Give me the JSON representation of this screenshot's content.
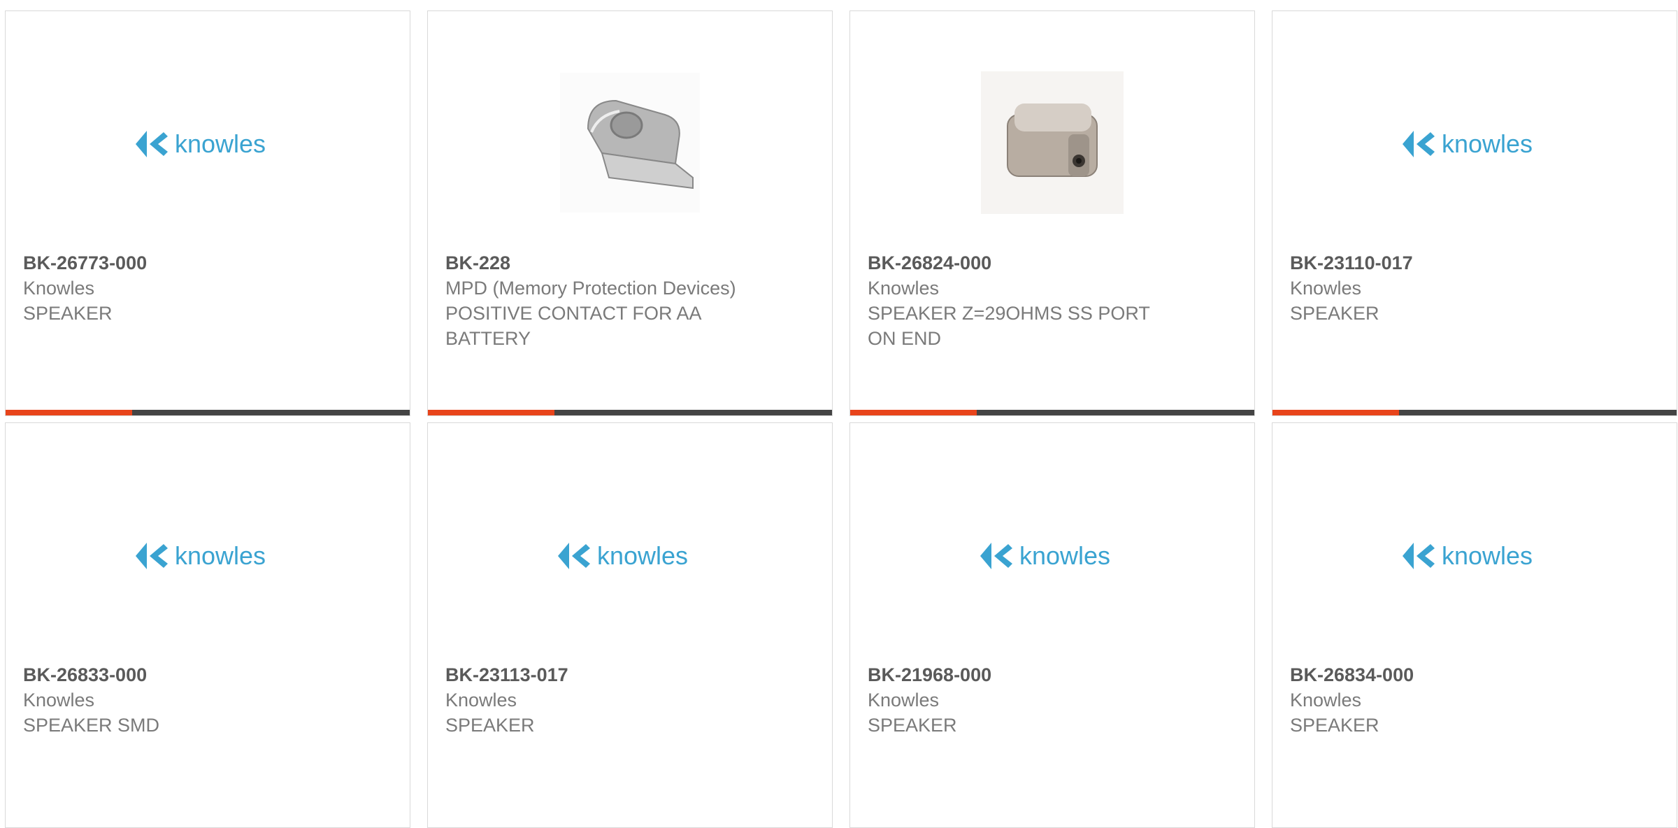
{
  "colors": {
    "accent": "#e8441b",
    "bar": "#444444",
    "logo_blue": "#3aa3d1"
  },
  "products": [
    {
      "part_number": "BK-26773-000",
      "manufacturer": "Knowles",
      "description": "SPEAKER",
      "image": "knowles-logo",
      "logo_text": "knowles"
    },
    {
      "part_number": "BK-228",
      "manufacturer": "MPD (Memory Protection Devices)",
      "description": "POSITIVE CONTACT FOR AA BATTERY",
      "image": "battery-contact-photo"
    },
    {
      "part_number": "BK-26824-000",
      "manufacturer": "Knowles",
      "description": "SPEAKER Z=29OHMS SS PORT ON END",
      "image": "speaker-photo"
    },
    {
      "part_number": "BK-23110-017",
      "manufacturer": "Knowles",
      "description": "SPEAKER",
      "image": "knowles-logo",
      "logo_text": "knowles"
    },
    {
      "part_number": "BK-26833-000",
      "manufacturer": "Knowles",
      "description": "SPEAKER SMD",
      "image": "knowles-logo",
      "logo_text": "knowles"
    },
    {
      "part_number": "BK-23113-017",
      "manufacturer": "Knowles",
      "description": "SPEAKER",
      "image": "knowles-logo",
      "logo_text": "knowles"
    },
    {
      "part_number": "BK-21968-000",
      "manufacturer": "Knowles",
      "description": "SPEAKER",
      "image": "knowles-logo",
      "logo_text": "knowles"
    },
    {
      "part_number": "BK-26834-000",
      "manufacturer": "Knowles",
      "description": "SPEAKER",
      "image": "knowles-logo",
      "logo_text": "knowles"
    }
  ]
}
